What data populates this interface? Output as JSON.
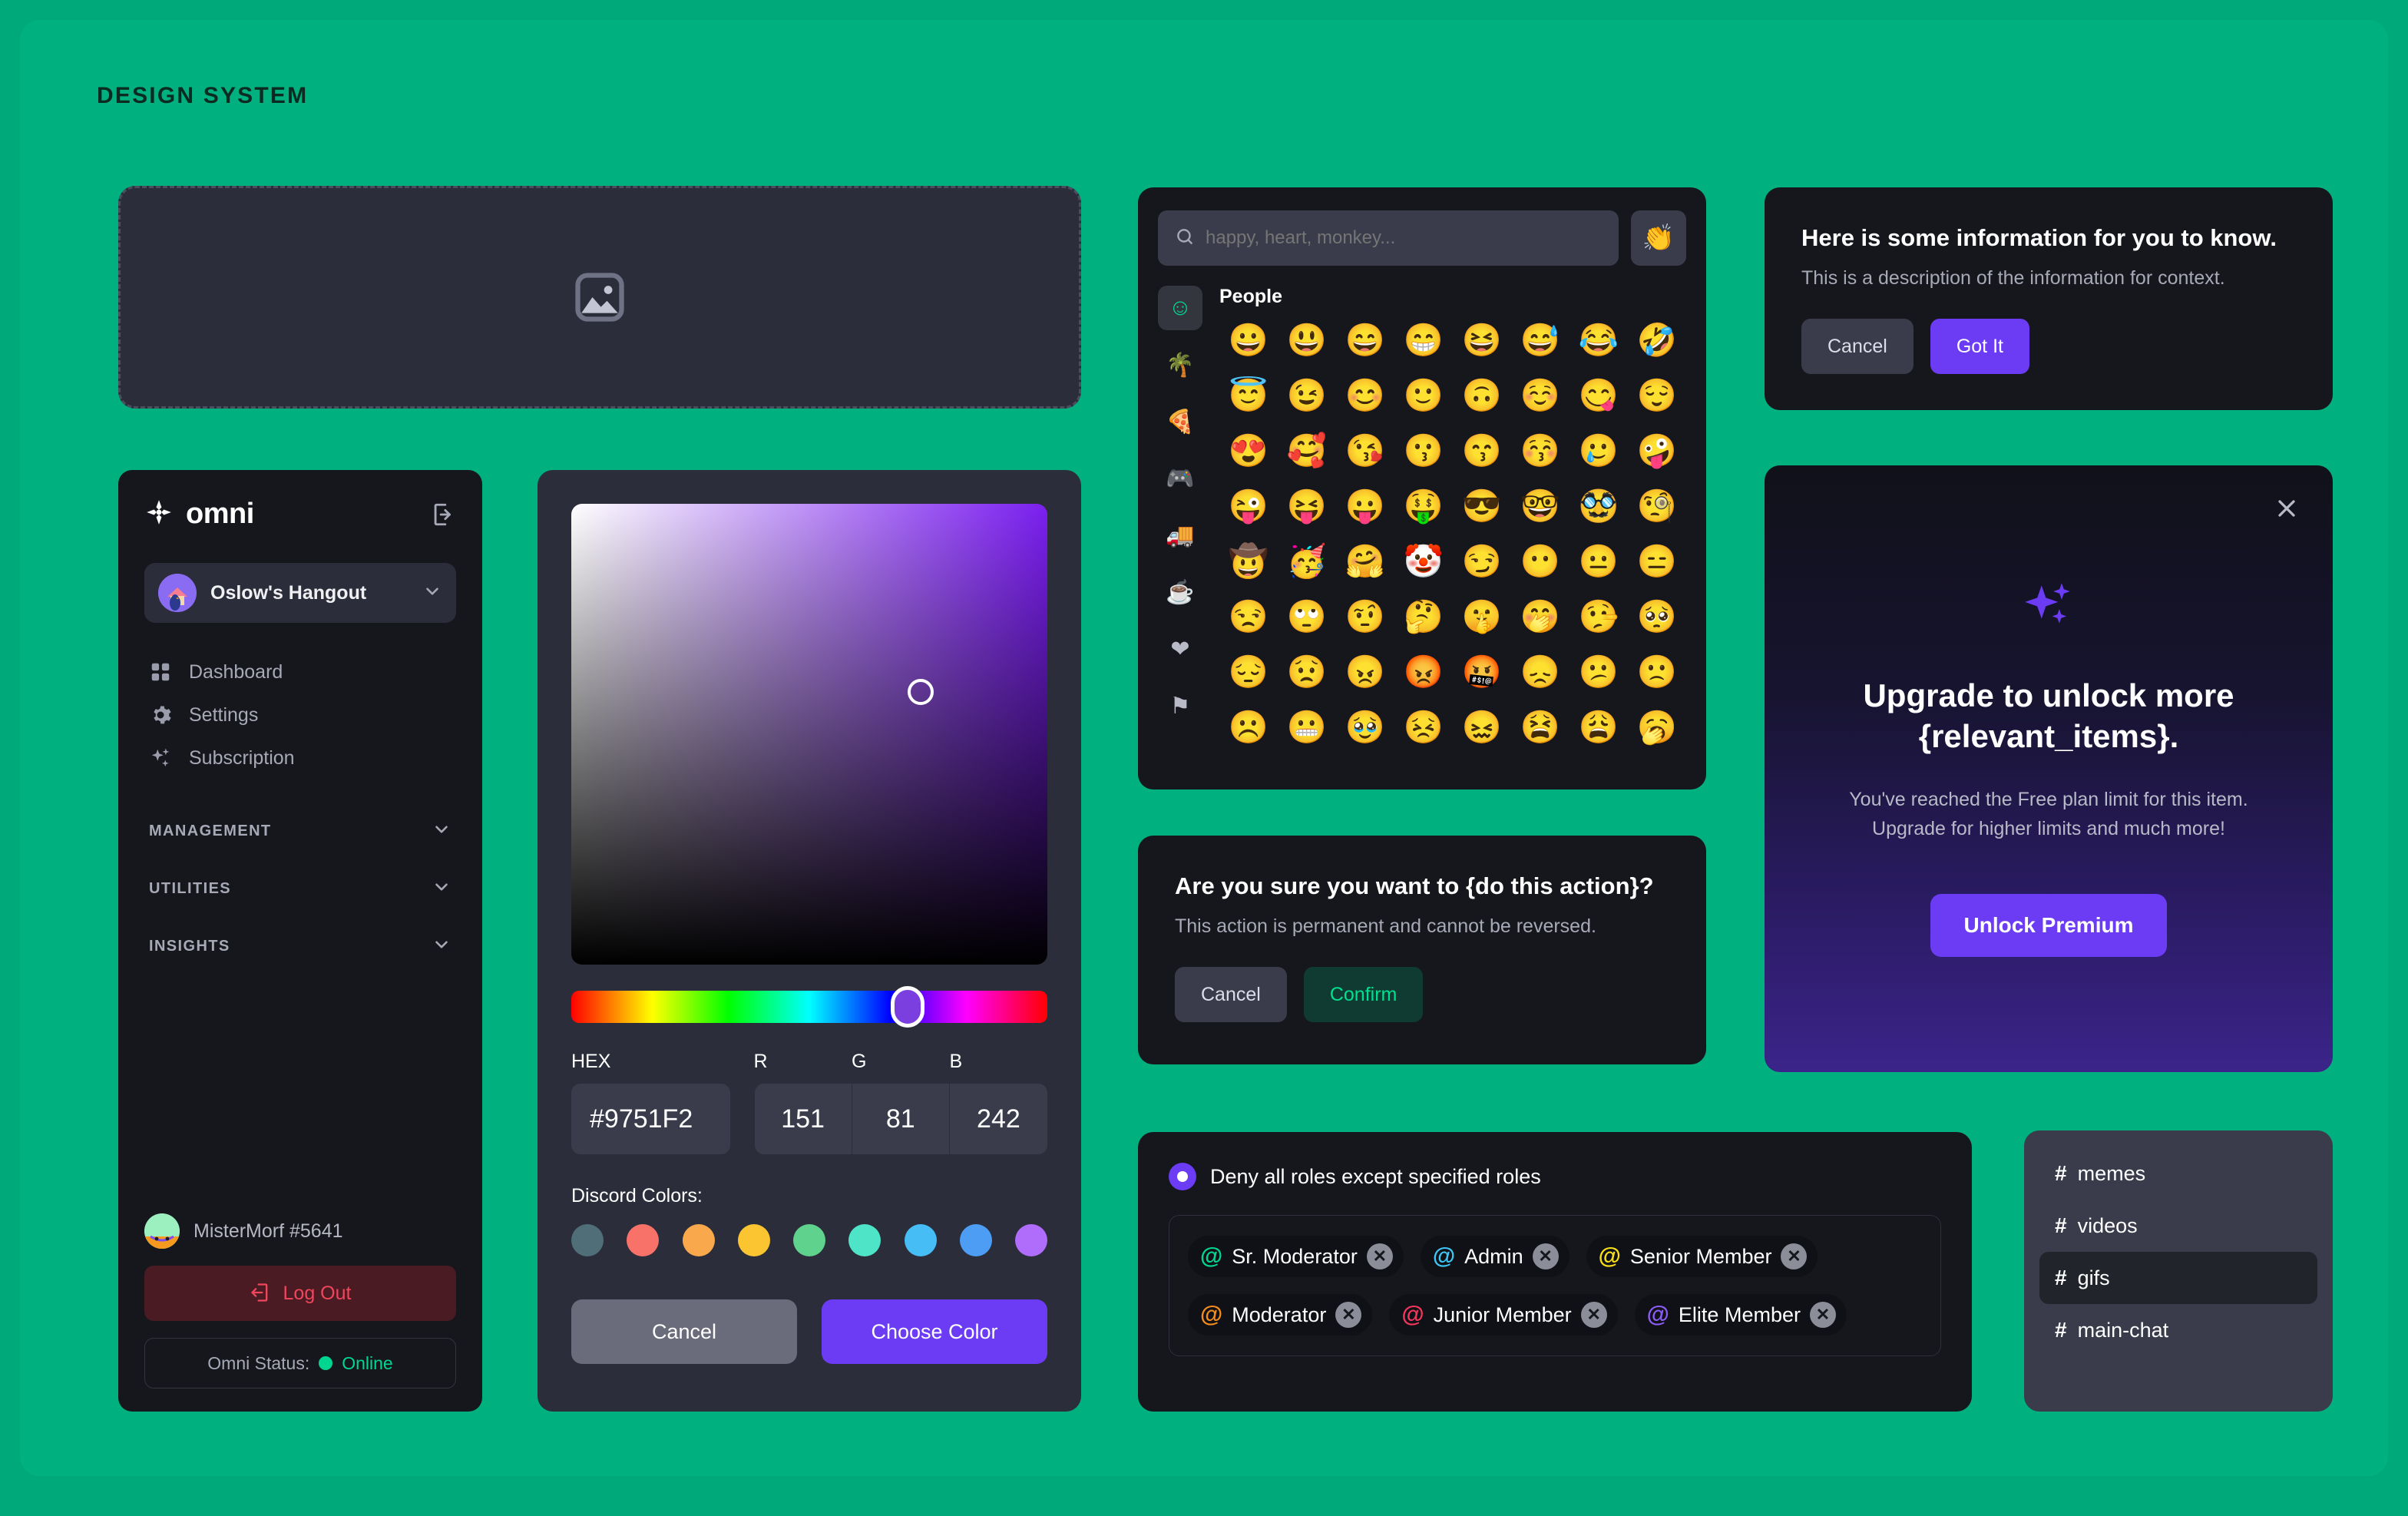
{
  "page": {
    "title": "DESIGN SYSTEM",
    "background_color": "#00b07f",
    "outer_background_color": "#00a97a",
    "accent_violet": "#6c3cf5",
    "accent_green": "#00d68f",
    "surface_dark": "#16171d",
    "surface_mid": "#2b2d3a",
    "surface_light": "#3a3c4b"
  },
  "dropzone": {
    "icon": "image-placeholder-icon"
  },
  "sidebar": {
    "brand": "omni",
    "logo_icon": "omni-logo-icon",
    "logout_icon": "logout-arrow-icon",
    "server": {
      "name": "Oslow's Hangout",
      "chevron_icon": "chevron-down-icon",
      "avatar": "server-avatar"
    },
    "nav_items": [
      {
        "label": "Dashboard",
        "icon": "grid-icon"
      },
      {
        "label": "Settings",
        "icon": "gear-icon"
      },
      {
        "label": "Subscription",
        "icon": "sparkles-icon"
      }
    ],
    "sections": [
      {
        "label": "MANAGEMENT",
        "icon": "chevron-down-icon"
      },
      {
        "label": "UTILITIES",
        "icon": "chevron-down-icon"
      },
      {
        "label": "INSIGHTS",
        "icon": "chevron-down-icon"
      }
    ],
    "user": {
      "name": "MisterMorf #5641",
      "avatar": "user-avatar"
    },
    "logout_label": "Log Out",
    "logout_button_icon": "logout-arrow-icon",
    "status_label": "Omni Status:",
    "status_value": "Online",
    "status_color": "#00d68f"
  },
  "color_picker": {
    "selected_color": "#9751F2",
    "hex_label": "HEX",
    "hex_value": "#9751F2",
    "r_label": "R",
    "r_value": "151",
    "g_label": "G",
    "g_value": "81",
    "b_label": "B",
    "b_value": "242",
    "discord_colors_label": "Discord Colors:",
    "swatches": [
      "#4f6e78",
      "#f9726a",
      "#f9a94c",
      "#fbc531",
      "#5fd38d",
      "#4ee4c8",
      "#46bdf5",
      "#4d9df5",
      "#b06cfb"
    ],
    "cancel_label": "Cancel",
    "choose_label": "Choose Color"
  },
  "emoji_picker": {
    "search_placeholder": "happy, heart, monkey...",
    "search_icon": "search-icon",
    "quick_emoji": "👏",
    "category_title": "People",
    "categories": [
      {
        "name": "smileys-category",
        "glyph": "☺",
        "active": true
      },
      {
        "name": "nature-category",
        "glyph": "🌴",
        "active": false
      },
      {
        "name": "food-category",
        "glyph": "🍕",
        "active": false
      },
      {
        "name": "activities-category",
        "glyph": "🎮",
        "active": false
      },
      {
        "name": "travel-category",
        "glyph": "🚚",
        "active": false
      },
      {
        "name": "objects-category",
        "glyph": "☕",
        "active": false
      },
      {
        "name": "symbols-category",
        "glyph": "❤",
        "active": false
      },
      {
        "name": "flags-category",
        "glyph": "⚑",
        "active": false
      }
    ],
    "emojis": [
      "😀",
      "😃",
      "😄",
      "😁",
      "😆",
      "😅",
      "😂",
      "🤣",
      "😇",
      "😉",
      "😊",
      "🙂",
      "🙃",
      "☺️",
      "😋",
      "😌",
      "😍",
      "🥰",
      "😘",
      "😗",
      "😙",
      "😚",
      "🥲",
      "🤪",
      "😜",
      "😝",
      "😛",
      "🤑",
      "😎",
      "🤓",
      "🥸",
      "🧐",
      "🤠",
      "🥳",
      "🤗",
      "🤡",
      "😏",
      "😶",
      "😐",
      "😑",
      "😒",
      "🙄",
      "🤨",
      "🤔",
      "🤫",
      "🤭",
      "🤥",
      "🥺",
      "😔",
      "😟",
      "😠",
      "😡",
      "🤬",
      "😞",
      "😕",
      "🙁",
      "☹️",
      "😬",
      "🥹",
      "😣",
      "😖",
      "😫",
      "😩",
      "🥱"
    ]
  },
  "confirm_dialog": {
    "title": "Are you sure you want to {do this action}?",
    "description": "This action is permanent and cannot be reversed.",
    "cancel_label": "Cancel",
    "confirm_label": "Confirm"
  },
  "info_dialog": {
    "title": "Here is some information for you to know.",
    "description": "This is a description of the information for context.",
    "cancel_label": "Cancel",
    "confirm_label": "Got It"
  },
  "upgrade_card": {
    "close_icon": "close-icon",
    "sparkle_icon": "sparkles-icon",
    "title": "Upgrade to unlock more {relevant_items}.",
    "description_line1": "You've reached the Free plan limit for this item.",
    "description_line2": "Upgrade for higher limits and much more!",
    "button_label": "Unlock Premium"
  },
  "roles_panel": {
    "radio_label": "Deny all roles except specified roles",
    "radio_selected": true,
    "roles": [
      {
        "name": "Sr. Moderator",
        "color": "#00d68f"
      },
      {
        "name": "Admin",
        "color": "#3fc6f5"
      },
      {
        "name": "Senior Member",
        "color": "#f7e017"
      },
      {
        "name": "Moderator",
        "color": "#f58c1a"
      },
      {
        "name": "Junior Member",
        "color": "#f5365c"
      },
      {
        "name": "Elite Member",
        "color": "#8b5cf6"
      }
    ],
    "remove_icon": "close-circle-icon"
  },
  "channel_list": {
    "items": [
      {
        "label": "memes",
        "active": false
      },
      {
        "label": "videos",
        "active": false
      },
      {
        "label": "gifs",
        "active": true
      },
      {
        "label": "main-chat",
        "active": false
      }
    ],
    "hash": "#"
  }
}
